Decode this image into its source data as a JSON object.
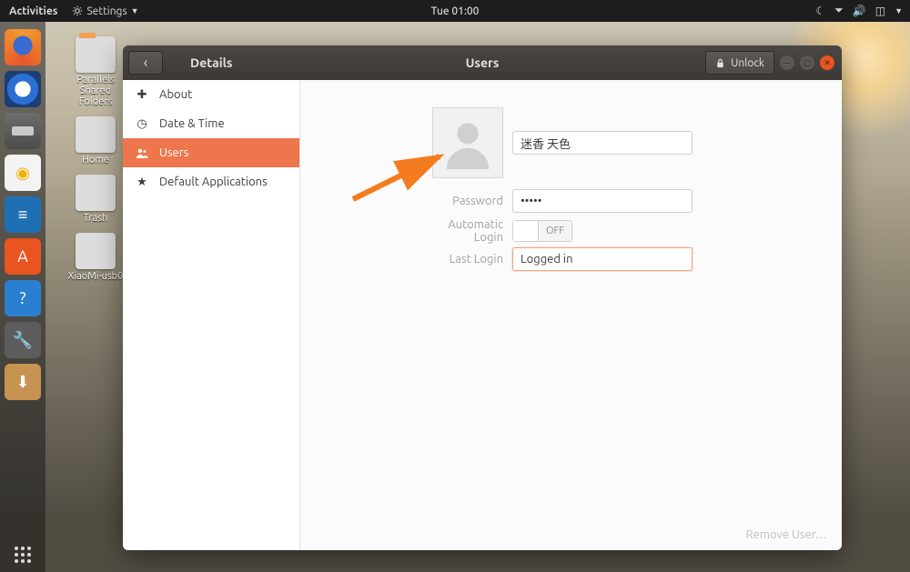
{
  "topbar": {
    "activities": "Activities",
    "app_menu": "Settings",
    "clock": "Tue 01:00"
  },
  "desktop": {
    "icons": [
      {
        "label": "Parallels Shared Folders"
      },
      {
        "label": "Home"
      },
      {
        "label": "Trash"
      },
      {
        "label": "XiaoMi-usb0"
      }
    ]
  },
  "window": {
    "section": "Details",
    "title": "Users",
    "unlock_label": "Unlock",
    "sidebar": {
      "items": [
        {
          "label": "About"
        },
        {
          "label": "Date & Time"
        },
        {
          "label": "Users"
        },
        {
          "label": "Default Applications"
        }
      ],
      "active_index": 2
    },
    "user": {
      "name": "迷香 天色",
      "password_label": "Password",
      "password_mask": "•••••",
      "auto_login_label": "Automatic Login",
      "auto_login_state": "OFF",
      "last_login_label": "Last Login",
      "last_login_value": "Logged in"
    },
    "remove_user_label": "Remove User…"
  },
  "icons": {
    "back": "‹",
    "lock": "lock-icon",
    "plus": "✚",
    "clock": "◷",
    "users": "👥",
    "star": "★"
  }
}
